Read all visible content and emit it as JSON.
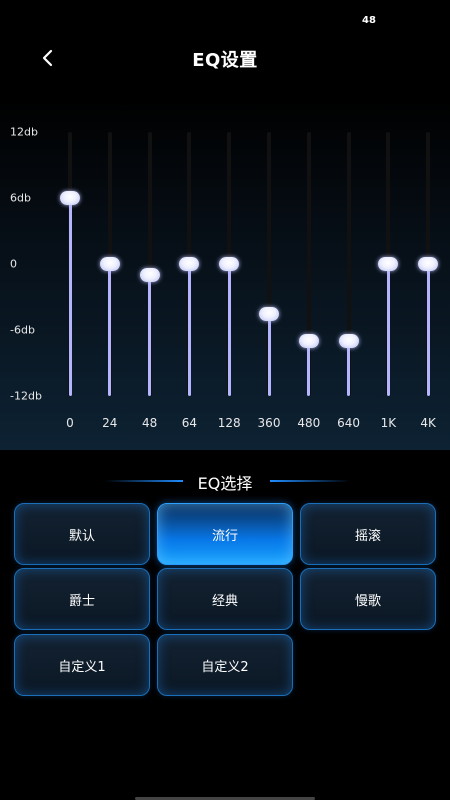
{
  "status": {
    "badge": "48"
  },
  "header": {
    "title": "EQ设置"
  },
  "eq": {
    "db_labels": [
      {
        "text": "12db",
        "value": 12
      },
      {
        "text": "6db",
        "value": 6
      },
      {
        "text": "0",
        "value": 0
      },
      {
        "text": "-6db",
        "value": -6
      },
      {
        "text": "-12db",
        "value": -12
      }
    ],
    "db_range": [
      -12,
      12
    ],
    "bands": [
      {
        "label": "0",
        "value": 6
      },
      {
        "label": "24",
        "value": 0
      },
      {
        "label": "48",
        "value": -1
      },
      {
        "label": "64",
        "value": 0
      },
      {
        "label": "128",
        "value": 0
      },
      {
        "label": "360",
        "value": -4.5
      },
      {
        "label": "480",
        "value": -7
      },
      {
        "label": "640",
        "value": -7
      },
      {
        "label": "1K",
        "value": 0
      },
      {
        "label": "4K",
        "value": 0
      }
    ],
    "fill_color": "#b3b6ff"
  },
  "presets": {
    "title": "EQ选择",
    "selected": "流行",
    "items": [
      {
        "label": "默认"
      },
      {
        "label": "流行"
      },
      {
        "label": "摇滚"
      },
      {
        "label": "爵士"
      },
      {
        "label": "经典"
      },
      {
        "label": "慢歌"
      },
      {
        "label": "自定义1"
      },
      {
        "label": "自定义2"
      }
    ],
    "accent_color": "#1f8dff"
  }
}
